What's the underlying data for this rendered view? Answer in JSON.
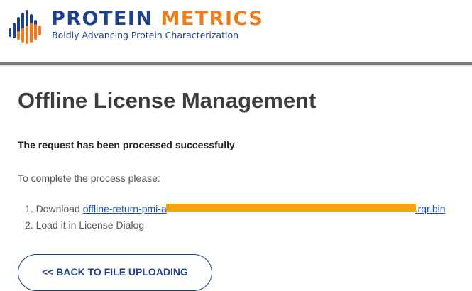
{
  "header": {
    "logo_word1": "PROTEIN",
    "logo_word2": "METRICS",
    "tagline": "Boldly Advancing Protein Characterization",
    "colors": {
      "navy": "#1f3f8f",
      "orange": "#f07b1c"
    },
    "logo_icon": "stacked-bars-logo-icon"
  },
  "main": {
    "title": "Offline License Management",
    "status": "The request has been processed successfully",
    "instructions": "To complete the process please:",
    "steps": [
      {
        "number": "1.",
        "prefix": "Download ",
        "link_start": "offline-return-pmi-a",
        "link_end": ".rqr.bin"
      },
      {
        "number": "2.",
        "text": "Load it in License Dialog"
      }
    ],
    "redaction_color": "#f5a40a",
    "link_color": "#1a4bc4",
    "back_button_label": "<< BACK TO FILE UPLOADING"
  }
}
